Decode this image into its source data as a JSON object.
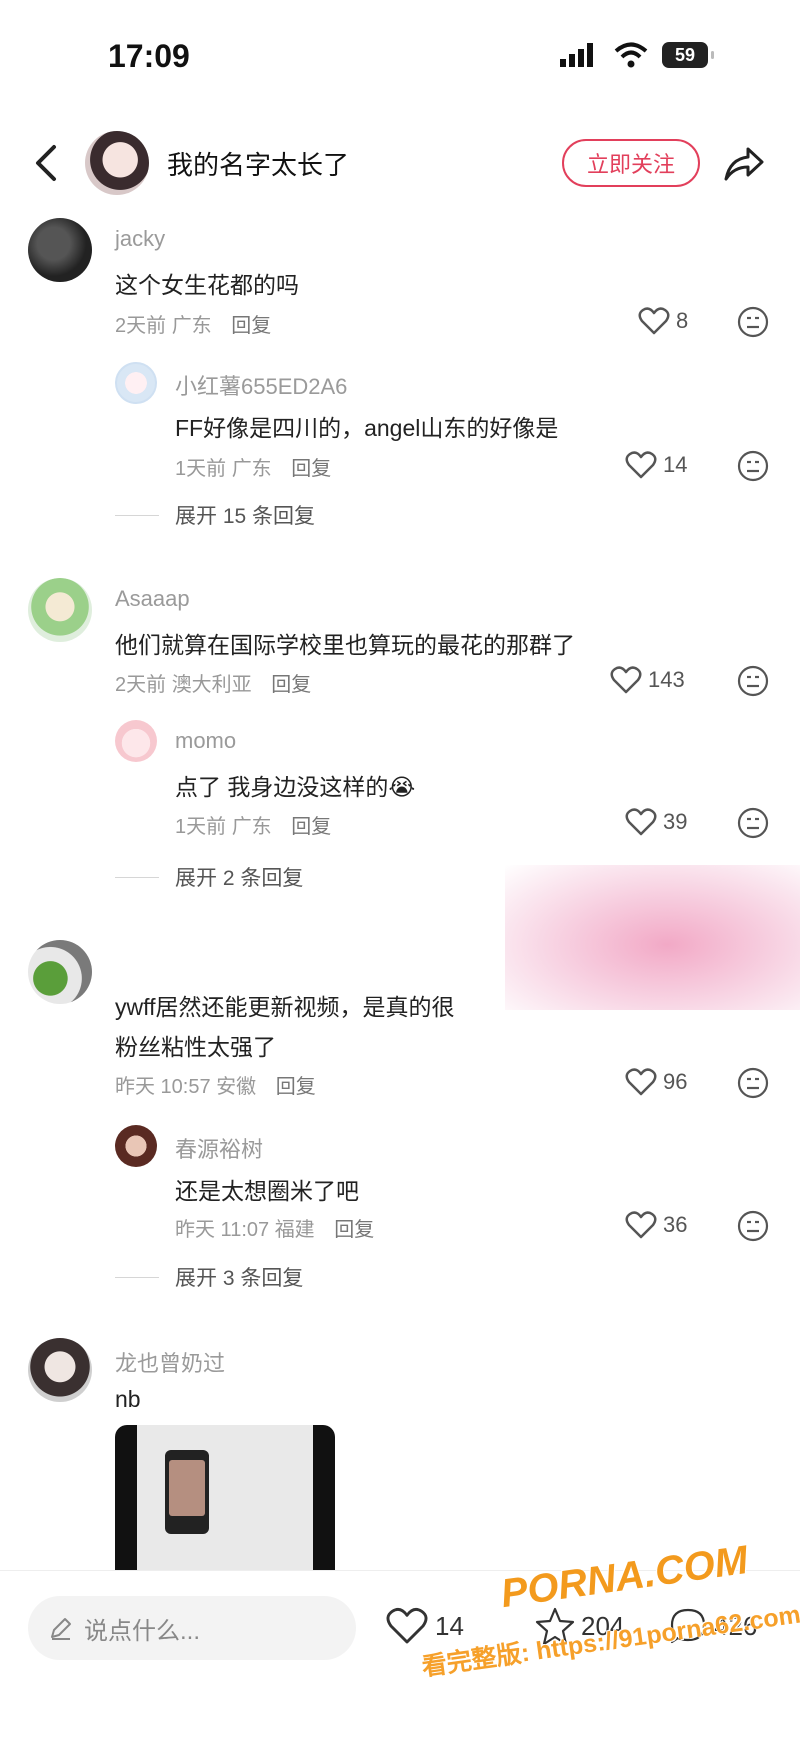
{
  "status_bar": {
    "time": "17:09",
    "battery": "59"
  },
  "header": {
    "author": "我的名字太长了",
    "follow_label": "立即关注"
  },
  "comments": [
    {
      "user": "jacky",
      "text": "这个女生花都的吗",
      "time": "2天前",
      "location": "广东",
      "reply_label": "回复",
      "likes": "8",
      "reply": {
        "user": "小红薯655ED2A6",
        "text": "FF好像是四川的，angel山东的好像是",
        "time": "1天前",
        "location": "广东",
        "reply_label": "回复",
        "likes": "14"
      },
      "expand_label": "展开 15 条回复"
    },
    {
      "user": "Asaaap",
      "text": "他们就算在国际学校里也算玩的最花的那群了",
      "time": "2天前",
      "location": "澳大利亚",
      "reply_label": "回复",
      "likes": "143",
      "reply": {
        "user": "momo",
        "text": "点了 我身边没这样的",
        "emoji": "😭",
        "time": "1天前",
        "location": "广东",
        "reply_label": "回复",
        "likes": "39"
      },
      "expand_label": "展开 2 条回复"
    },
    {
      "user": "",
      "text_line1": "ywff居然还能更新视频，是真的很",
      "text_line2": "粉丝粘性太强了",
      "time": "昨天 10:57",
      "location": "安徽",
      "reply_label": "回复",
      "likes": "96",
      "reply": {
        "user": "春源裕树",
        "text": "还是太想圈米了吧",
        "time": "昨天 11:07",
        "location": "福建",
        "reply_label": "回复",
        "likes": "36"
      },
      "expand_label": "展开 3 条回复"
    },
    {
      "user": "龙也曾奶过",
      "text": "nb"
    }
  ],
  "bottom_bar": {
    "input_placeholder": "说点什么...",
    "likes": "14",
    "collects": "204",
    "comments": "426"
  },
  "watermark": {
    "logo": "PORNA.COM",
    "url_text": "看完整版: https://91porna62.com"
  },
  "colors": {
    "accent": "#e23f5b",
    "watermark": "#f39a1d"
  },
  "icons": [
    "back-icon",
    "share-icon",
    "heart-icon",
    "dislike-icon",
    "pencil-icon",
    "star-icon",
    "comment-bubble-icon"
  ]
}
